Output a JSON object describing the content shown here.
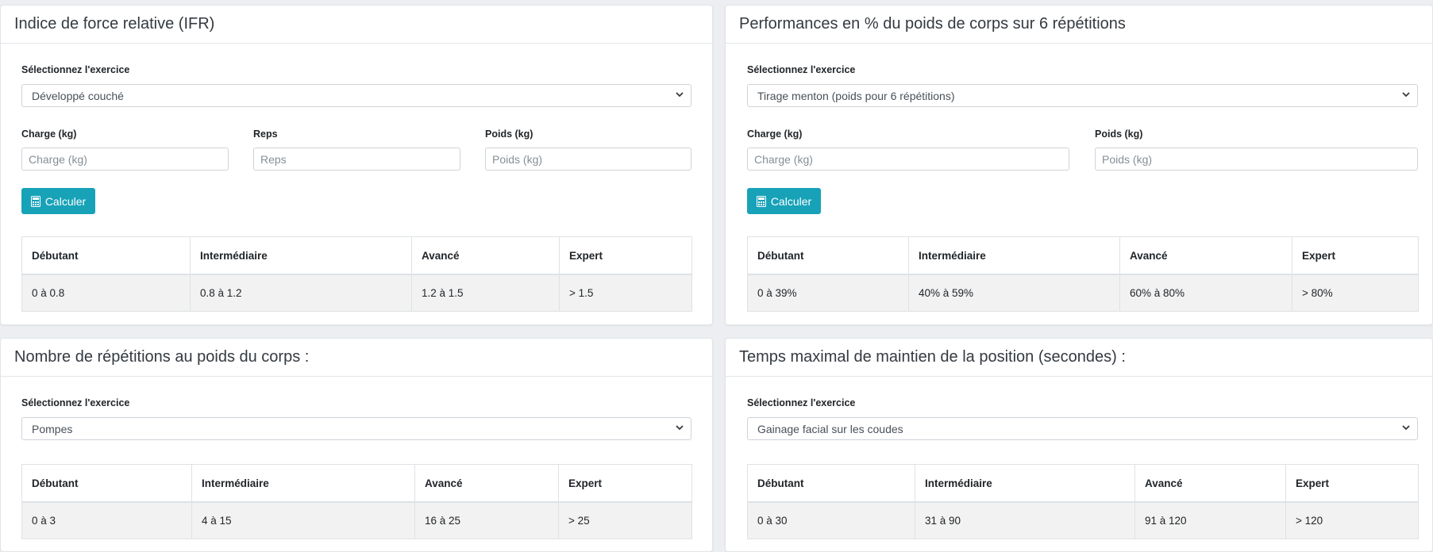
{
  "common": {
    "select_label": "Sélectionnez l'exercice",
    "calc_label": "Calculer"
  },
  "ifr": {
    "title": "Indice de force relative (IFR)",
    "selected": "Développé couché",
    "charge_label": "Charge (kg)",
    "charge_placeholder": "Charge (kg)",
    "reps_label": "Reps",
    "reps_placeholder": "Reps",
    "poids_label": "Poids (kg)",
    "poids_placeholder": "Poids (kg)",
    "headers": [
      "Débutant",
      "Intermédiaire",
      "Avancé",
      "Expert"
    ],
    "values": [
      "0 à 0.8",
      "0.8 à 1.2",
      "1.2 à 1.5",
      "> 1.5"
    ]
  },
  "perf": {
    "title": "Performances en % du poids de corps sur 6 répétitions",
    "selected": "Tirage menton (poids pour 6 répétitions)",
    "charge_label": "Charge (kg)",
    "charge_placeholder": "Charge (kg)",
    "poids_label": "Poids (kg)",
    "poids_placeholder": "Poids (kg)",
    "headers": [
      "Débutant",
      "Intermédiaire",
      "Avancé",
      "Expert"
    ],
    "values": [
      "0 à 39%",
      "40% à 59%",
      "60% à 80%",
      "> 80%"
    ]
  },
  "reps": {
    "title": "Nombre de répétitions au poids du corps :",
    "selected": "Pompes",
    "headers": [
      "Débutant",
      "Intermédiaire",
      "Avancé",
      "Expert"
    ],
    "values": [
      "0 à 3",
      "4 à 15",
      "16 à 25",
      "> 25"
    ]
  },
  "hold": {
    "title": "Temps maximal de maintien de la position (secondes) :",
    "selected": "Gainage facial sur les coudes",
    "headers": [
      "Débutant",
      "Intermédiaire",
      "Avancé",
      "Expert"
    ],
    "values": [
      "0 à 30",
      "31 à 90",
      "91 à 120",
      "> 120"
    ]
  },
  "colors": {
    "accent": "#17a2b8",
    "background": "#eceef1"
  }
}
